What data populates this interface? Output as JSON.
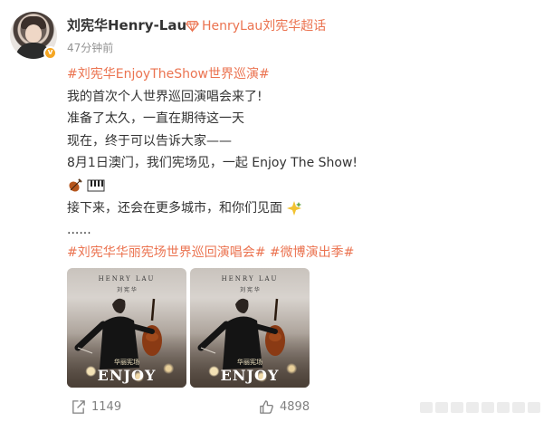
{
  "post": {
    "author": "刘宪华Henry-Lau",
    "super_topic": "HenryLau刘宪华超话",
    "time": "47分钟前",
    "verified_badge": "v",
    "lines": [
      {
        "tag": "#刘宪华EnjoyTheShow世界巡演#",
        "text": ""
      },
      {
        "tag": "",
        "text": "我的首次个人世界巡回演唱会来了!"
      },
      {
        "tag": "",
        "text": "准备了太久，一直在期待这一天"
      },
      {
        "tag": "",
        "text": "现在，终于可以告诉大家——"
      },
      {
        "tag": "",
        "text": "8月1日澳门，我们宪场见，一起 Enjoy The Show!"
      },
      {
        "tag": "",
        "text": ""
      },
      {
        "tag": "",
        "text": "接下来，还会在更多城市，和你们见面"
      },
      {
        "tag": "",
        "text": "......"
      }
    ],
    "hashtags": [
      "#刘宪华华丽宪场世界巡回演唱会#",
      "#微博演出季#"
    ],
    "icons": [
      "violin-emoji",
      "piano-emoji",
      "sparkle-emoji"
    ]
  },
  "photos": [
    {
      "name_en": "HENRY LAU",
      "name_cn": "刘 宪 华",
      "subtitle": "华丽宪场",
      "title": "ENJOY"
    },
    {
      "name_en": "HENRY LAU",
      "name_cn": "刘 宪 华",
      "subtitle": "华丽宪场",
      "title": "ENJOY"
    }
  ],
  "footer": {
    "share_count": "1149",
    "like_count": "4898"
  },
  "colors": {
    "accent": "#eb7350",
    "muted": "#939393",
    "text": "#333333"
  }
}
